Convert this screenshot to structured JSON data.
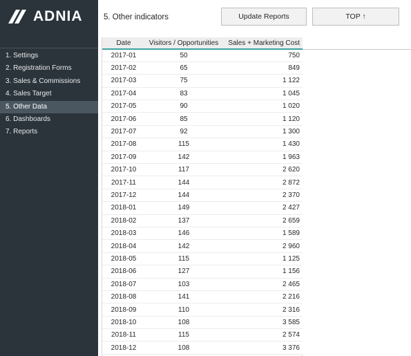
{
  "brand": {
    "name": "ADNIA"
  },
  "sidebar": {
    "items": [
      {
        "label": "1. Settings",
        "active": false
      },
      {
        "label": "2. Registration Forms",
        "active": false
      },
      {
        "label": "3. Sales & Commissions",
        "active": false
      },
      {
        "label": "4. Sales Target",
        "active": false
      },
      {
        "label": "5. Other Data",
        "active": true
      },
      {
        "label": "6. Dashboards",
        "active": false
      },
      {
        "label": "7. Reports",
        "active": false
      }
    ]
  },
  "header": {
    "title": "5. Other indicators",
    "update_label": "Update Reports",
    "top_label": "TOP ↑"
  },
  "table": {
    "columns": [
      "Date",
      "Visitors / Opportunities",
      "Sales + Marketing Cost"
    ],
    "rows": [
      [
        "2017-01",
        "50",
        "750"
      ],
      [
        "2017-02",
        "65",
        "849"
      ],
      [
        "2017-03",
        "75",
        "1 122"
      ],
      [
        "2017-04",
        "83",
        "1 045"
      ],
      [
        "2017-05",
        "90",
        "1 020"
      ],
      [
        "2017-06",
        "85",
        "1 120"
      ],
      [
        "2017-07",
        "92",
        "1 300"
      ],
      [
        "2017-08",
        "115",
        "1 430"
      ],
      [
        "2017-09",
        "142",
        "1 963"
      ],
      [
        "2017-10",
        "117",
        "2 620"
      ],
      [
        "2017-11",
        "144",
        "2 872"
      ],
      [
        "2017-12",
        "144",
        "2 370"
      ],
      [
        "2018-01",
        "149",
        "2 427"
      ],
      [
        "2018-02",
        "137",
        "2 659"
      ],
      [
        "2018-03",
        "146",
        "1 589"
      ],
      [
        "2018-04",
        "142",
        "2 960"
      ],
      [
        "2018-05",
        "115",
        "1 125"
      ],
      [
        "2018-06",
        "127",
        "1 156"
      ],
      [
        "2018-07",
        "103",
        "2 465"
      ],
      [
        "2018-08",
        "141",
        "2 216"
      ],
      [
        "2018-09",
        "110",
        "2 316"
      ],
      [
        "2018-10",
        "108",
        "3 585"
      ],
      [
        "2018-11",
        "115",
        "2 574"
      ],
      [
        "2018-12",
        "108",
        "3 376"
      ]
    ]
  },
  "colors": {
    "sidebar_bg": "#2b343b",
    "active_item_bg": "#4a5660",
    "header_accent": "#3da3a3"
  }
}
